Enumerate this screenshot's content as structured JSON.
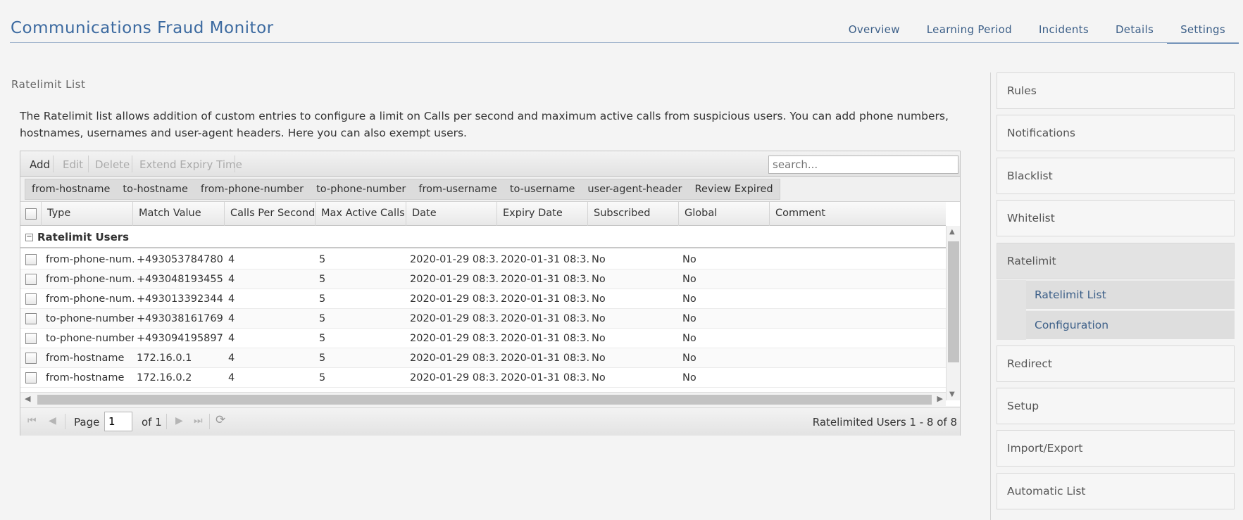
{
  "app": {
    "title": "Communications Fraud Monitor"
  },
  "nav": {
    "items": [
      {
        "label": "Overview"
      },
      {
        "label": "Learning Period"
      },
      {
        "label": "Incidents"
      },
      {
        "label": "Details"
      },
      {
        "label": "Settings",
        "active": true
      }
    ]
  },
  "page": {
    "title": "Ratelimit List",
    "description": "The Ratelimit list allows addition of custom entries to configure a limit on Calls per second and maximum active calls from suspicious users. You can add phone numbers, hostnames, usernames and user-agent headers. Here you can also exempt users."
  },
  "toolbar": {
    "add": "Add",
    "edit": "Edit",
    "delete": "Delete",
    "extend": "Extend Expiry Time",
    "search_placeholder": "search..."
  },
  "filters": [
    "from-hostname",
    "to-hostname",
    "from-phone-number",
    "to-phone-number",
    "from-username",
    "to-username",
    "user-agent-header",
    "Review Expired"
  ],
  "columns": [
    "Type",
    "Match Value",
    "Calls Per Second",
    "Max Active Calls",
    "Date",
    "Expiry Date",
    "Subscribed",
    "Global",
    "Comment"
  ],
  "group": {
    "label": "Ratelimit Users"
  },
  "rows": [
    [
      "from-phone-num...",
      "+493053784780",
      "4",
      "5",
      "2020-01-29 08:3...",
      "2020-01-31 08:3...",
      "No",
      "No",
      ""
    ],
    [
      "from-phone-num...",
      "+493048193455",
      "4",
      "5",
      "2020-01-29 08:3...",
      "2020-01-31 08:3...",
      "No",
      "No",
      ""
    ],
    [
      "from-phone-num...",
      "+493013392344",
      "4",
      "5",
      "2020-01-29 08:3...",
      "2020-01-31 08:3...",
      "No",
      "No",
      ""
    ],
    [
      "to-phone-number",
      "+493038161769",
      "4",
      "5",
      "2020-01-29 08:3...",
      "2020-01-31 08:3...",
      "No",
      "No",
      ""
    ],
    [
      "to-phone-number",
      "+493094195897",
      "4",
      "5",
      "2020-01-29 08:3...",
      "2020-01-31 08:3...",
      "No",
      "No",
      ""
    ],
    [
      "from-hostname",
      "172.16.0.1",
      "4",
      "5",
      "2020-01-29 08:3...",
      "2020-01-31 08:3...",
      "No",
      "No",
      ""
    ],
    [
      "from-hostname",
      "172.16.0.2",
      "4",
      "5",
      "2020-01-29 08:3...",
      "2020-01-31 08:3...",
      "No",
      "No",
      ""
    ]
  ],
  "pager": {
    "page_label": "Page",
    "page_value": "1",
    "of_label": "of 1",
    "status": "Ratelimited Users 1 - 8 of 8"
  },
  "sidebar": {
    "items": [
      {
        "label": "Rules"
      },
      {
        "label": "Notifications"
      },
      {
        "label": "Blacklist"
      },
      {
        "label": "Whitelist"
      },
      {
        "label": "Ratelimit",
        "active": true
      },
      {
        "label": "Redirect"
      },
      {
        "label": "Setup"
      },
      {
        "label": "Import/Export"
      },
      {
        "label": "Automatic List"
      }
    ],
    "subitems": [
      {
        "label": "Ratelimit List",
        "active": true
      },
      {
        "label": "Configuration"
      }
    ]
  },
  "colors": {
    "accent": "#3c6aa0",
    "nav_text": "#3c5f88"
  }
}
